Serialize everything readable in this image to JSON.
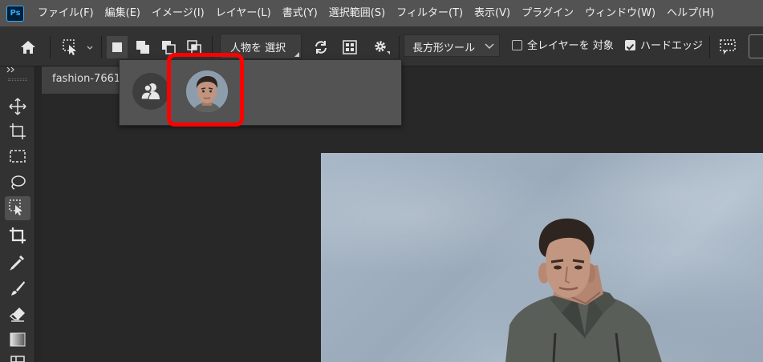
{
  "app": {
    "logo_text": "Ps",
    "accent": "#31a8ff"
  },
  "menu": {
    "items": [
      "ファイル(F)",
      "編集(E)",
      "イメージ(I)",
      "レイヤー(L)",
      "書式(Y)",
      "選択範囲(S)",
      "フィルター(T)",
      "表示(V)",
      "プラグイン",
      "ウィンドウ(W)",
      "ヘルプ(H)"
    ]
  },
  "options": {
    "subject_button": "人物を 選択",
    "tool_dropdown": "長方形ツール",
    "sample_all_layers": {
      "label": "全レイヤーを 対象",
      "checked": false
    },
    "hard_edge": {
      "label": "ハードエッジ",
      "checked": true
    }
  },
  "document": {
    "tab_label": "fashion-7661"
  },
  "popup": {
    "highlight_color": "#ff0000"
  },
  "icons": {
    "home": "home-icon",
    "tool_preset": "object-selection-icon",
    "new_selection": "new-selection-icon",
    "add_selection": "add-selection-icon",
    "subtract_selection": "subtract-selection-icon",
    "intersect_selection": "intersect-selection-icon",
    "refresh": "refresh-icon",
    "mask": "mask-icon",
    "settings": "gear-icon"
  }
}
